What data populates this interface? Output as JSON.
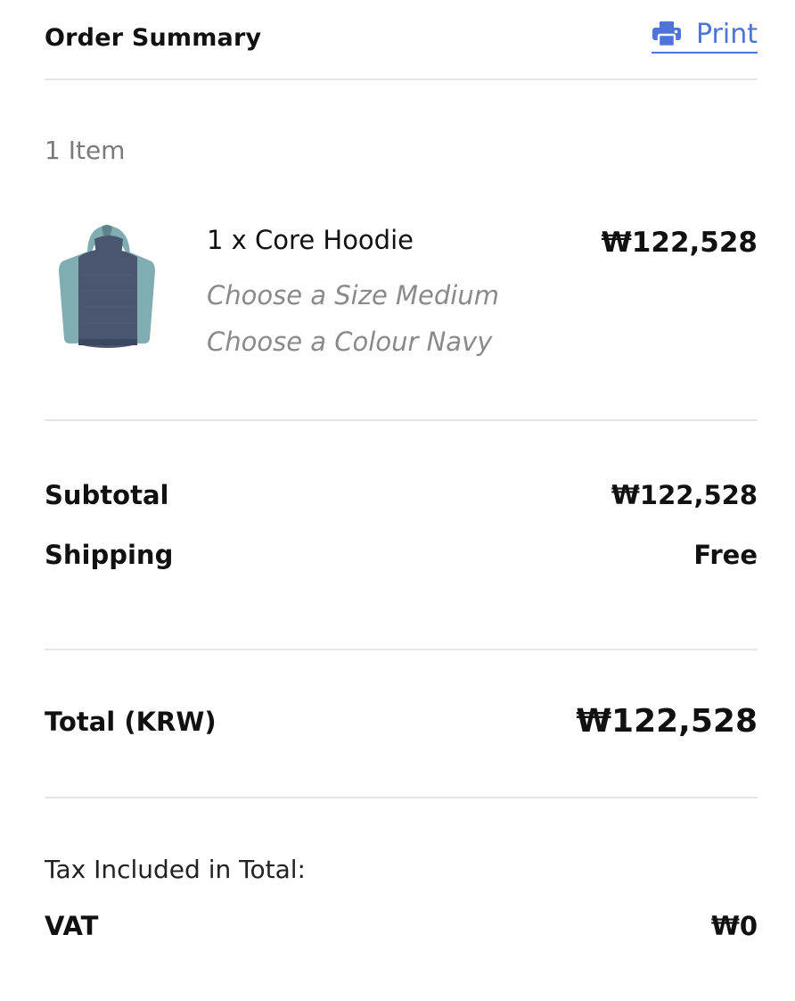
{
  "header": {
    "title": "Order Summary",
    "print_label": "Print",
    "print_icon": "printer-icon",
    "link_color": "#4e73d9"
  },
  "items": {
    "count_label": "1 Item",
    "list": [
      {
        "name": "1 x Core Hoodie",
        "size_option": "Choose a Size Medium",
        "colour_option": "Choose a Colour Navy",
        "price": "₩122,528",
        "image": "hoodie-image"
      }
    ]
  },
  "summary": {
    "subtotal_label": "Subtotal",
    "subtotal_value": "₩122,528",
    "shipping_label": "Shipping",
    "shipping_value": "Free"
  },
  "total": {
    "label": "Total (KRW)",
    "value": "₩122,528"
  },
  "tax": {
    "heading": "Tax Included in Total:",
    "vat_label": "VAT",
    "vat_value": "₩0"
  }
}
